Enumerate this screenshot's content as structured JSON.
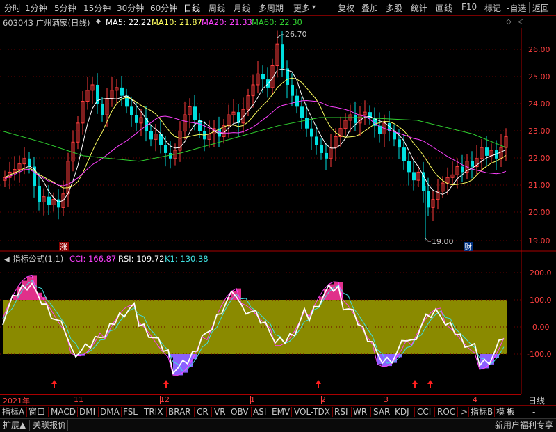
{
  "toolbar": {
    "periods": [
      "分时",
      "1分钟",
      "5分钟",
      "15分钟",
      "30分钟",
      "60分钟",
      "日线",
      "周线",
      "月线",
      "多周期",
      "更多"
    ],
    "active_period": "日线",
    "more_arrow": "▾",
    "right_buttons": [
      "复权",
      "叠加",
      "多股",
      "统计",
      "画线",
      "F10",
      "标记",
      "-自选",
      "返回"
    ]
  },
  "info": {
    "stock": "603043 广州酒家(日线)",
    "collapse_glyph": "◆",
    "ma5": "MA5: 22.22",
    "ma10": "MA10: 21.87",
    "ma20": "MA20: 21.33",
    "ma60": "MA60: 22.30",
    "right_glyph": "◇",
    "right_menu": "◁"
  },
  "main_chart": {
    "y_ticks": [
      "26.00",
      "25.00",
      "24.00",
      "23.00",
      "22.00",
      "21.00",
      "20.00",
      "19.00"
    ],
    "high_label": "26.70",
    "low_label": "19.00",
    "marker_zhang": "涨",
    "marker_cai": "财",
    "colors": {
      "up": "#ff3c3c",
      "down": "#00e0e0",
      "ma5": "#ffffff",
      "ma10": "#ffff60",
      "ma20": "#ff40ff",
      "ma60": "#30d030"
    }
  },
  "indicator": {
    "header_arrow": "◀",
    "title": "指标公式(1,1)",
    "cci": "CCI: 166.87",
    "rsi": "RSI: 109.72",
    "k1": "K1: 130.38",
    "y_ticks": [
      "200.0",
      "100.0",
      "0.00",
      "-100.0"
    ],
    "band_color": "#8a8a00"
  },
  "time_axis": {
    "labels": [
      "2021年",
      "11",
      "12",
      "1",
      "2",
      "3",
      "4"
    ],
    "period_label": "日线"
  },
  "tabs": {
    "items": [
      "指标A",
      "窗口",
      "MACD",
      "DMI",
      "DMA",
      "FSL",
      "TRIX",
      "BRAR",
      "CR",
      "VR",
      "OBV",
      "ASI",
      "EMV",
      "VOL-TDX",
      "RSI",
      "WR",
      "SAR",
      "KDJ",
      "CCI",
      "ROC"
    ],
    "more": ">",
    "right": [
      "指标B",
      "模",
      "板"
    ]
  },
  "bottombar": {
    "left": [
      "扩展▲",
      "关联报价"
    ],
    "right_buttons": [
      "+",
      "-"
    ],
    "status": "新用户福利专享"
  }
}
